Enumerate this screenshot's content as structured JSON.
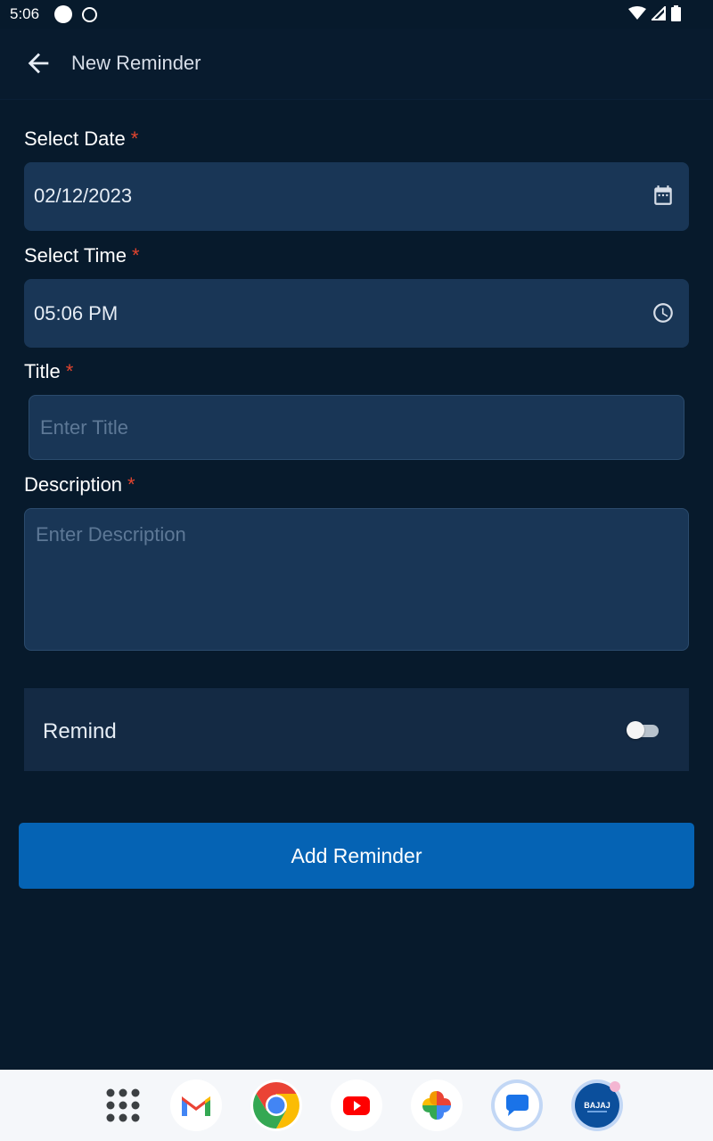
{
  "status_bar": {
    "time": "5:06"
  },
  "app_bar": {
    "title": "New Reminder",
    "back_icon": "arrow-left-icon"
  },
  "form": {
    "date": {
      "label": "Select Date",
      "required_mark": "*",
      "value": "02/12/2023",
      "icon": "calendar-icon"
    },
    "time": {
      "label": "Select Time",
      "required_mark": "*",
      "value": "05:06 PM",
      "icon": "clock-icon"
    },
    "title": {
      "label": "Title",
      "required_mark": "*",
      "value": "",
      "placeholder": "Enter Title"
    },
    "description": {
      "label": "Description",
      "required_mark": "*",
      "value": "",
      "placeholder": "Enter Description"
    },
    "remind": {
      "label": "Remind",
      "enabled": false
    },
    "submit_label": "Add Reminder"
  },
  "dock": {
    "apps": [
      "app-drawer-icon",
      "gmail-icon",
      "chrome-icon",
      "youtube-icon",
      "photos-icon",
      "messages-icon",
      "bajaj-icon"
    ]
  },
  "colors": {
    "background": "#071a2c",
    "field": "#193656",
    "accent": "#0563b4",
    "required": "#e2452f"
  }
}
